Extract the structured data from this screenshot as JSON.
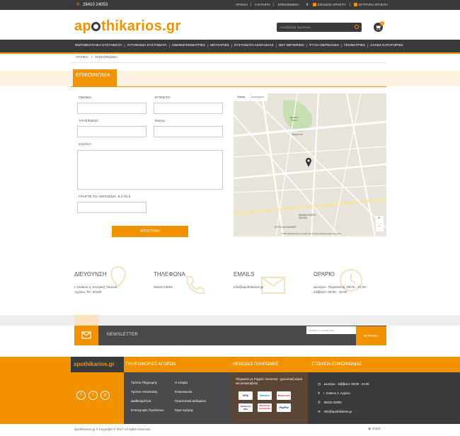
{
  "topbar": {
    "phone": "26410 24053",
    "links": [
      "ΑΡΧΙΚΗ",
      "Η ΕΤΑΙΡΙΑ",
      "ΕΠΙΚΟΙΝΩΝΙΑ"
    ],
    "login": "ΕΙΣΟΔΟΣ ΧΡΗΣΤΗ",
    "register": "ΕΓΓΡΑΦΗ ΧΡΗΣΤΗ"
  },
  "header": {
    "logo_a": "ap",
    "logo_b": "thikarios.gr",
    "search_placeholder": "Αναζήτηση προιόντα...",
    "cart_count": "0"
  },
  "nav": {
    "items": [
      "ΦΩΤΟΒΟΛΤΑΙΚΑ ΣΥΣΤΗΜΑΤΑ",
      "ΑΥΤΟΝΟΜΑ ΣΥΣΤΗΜΑΤΑ",
      "ΑΝΕΜΟΓΕΝΝΗΤΡΙΕΣ",
      "ΜΠΑΤΑΡΙΕΣ",
      "ΣΥΣΤΗΜΑΤΑ ΑΣΦΑΛΕΙΑΣ",
      "NET METERING",
      "ΨΥΞΗ ΘΕΡΜΑΝΣΗ",
      "ΓΕΝΝΗΤΡΙΕΣ",
      "ΑΛΛΕΣ ΚΑΤΗΓΟΡΙΕΣ"
    ]
  },
  "breadcrumb": {
    "home": "ΑΡΧΙΚΗ",
    "sep": "/",
    "current": "ΕΠΙΚΟΙΝΩΝΙΑ"
  },
  "page_title": "ΕΠΙΚΟΙΝΩΝΙΑ",
  "form": {
    "name": "ΟΝΟΜΑ:",
    "surname": "ΕΠΙΘΕΤΟ:",
    "phone": "ΤΗΛΕΦΩΝΟ:",
    "email": "EMAIL:",
    "comments": "ΣΧΟΛΙΑ:",
    "captcha": "ΓΡΑΨΤΕ ΤΟ ΑΘΡΟΙΣΜΑ: 8 ΣΥΝ 5",
    "send": "ΑΠΟΣΤΟΛΗ"
  },
  "map": {
    "tab_map": "Χάρτης",
    "tab_sat": "Δορυφόρος",
    "label_park": "Δημοτικό Πάρκο",
    "label_marketia": "Μαρκέτεια",
    "label_bavaria": "BAVARIA PARTS ΠΑΥΡΑΣ",
    "label_hotel": "HOTEL ALEXANDER",
    "zoom_in": "+",
    "zoom_out": "−",
    "attribution": "©2017 Δεδομένα χάρτη Google   Όροι Χρήσης   Αναφορά σφάλματος χάρτη"
  },
  "contact": {
    "address_title": "ΔΙΕΥΘΥΝΣΗ",
    "address_1": "Ι. Σταϊκου 2, Κεντρική Πλατεία",
    "address_2": "Αγρίνιο, ΤΚ: 30100",
    "phones_title": "ΤΗΛΕΦΩΝΑ",
    "phone": "26410 24053",
    "emails_title": "EMAILS",
    "email": "info@apothikarios.gr",
    "hours_title": "ΩΡΑΡΙΟ",
    "hours_1": "Δευτέρα - Παρασκευή: 09:00 - 21:00",
    "hours_2": "Σάββατο: 09:00 - 15:00"
  },
  "newsletter": {
    "label": "NEWSLETTER",
    "placeholder": "Γράψτε το email σας...",
    "button": "ΕΓΓΡΑΦΗ"
  },
  "footer": {
    "logo": "apothikarios.gr",
    "col1_title": "ΠΛΗΡΟΦΟΡΙΕΣ ΑΓΟΡΩΝ",
    "col1_links_a": [
      "Τρόποι Πληρωμής",
      "Τρόποι Αποστολής",
      "Διαθεσιμότητα",
      "Επιστροφές Προϊόντων"
    ],
    "col1_links_b": [
      "Η εταιρία",
      "Επικοινωνία",
      "Προσωπικά Δεδομένα",
      "Όροι Χρήσης"
    ],
    "col2_title": "ΜΕΘΟΔΟΙ ΠΛΗΡΩΜΗΣ",
    "col2_text": "Πληρώστε με Paypal, πιστωτική - χρεωστική κάρτα και αντικαταβολή",
    "cards": [
      "VISA",
      "Maestro",
      "MasterCard",
      "Verified by VISA",
      "MasterCard SecureCode",
      "PayPal"
    ],
    "col3_title": "ΣΤΟΙΧΕΙΑ ΕΠΙΚΟΙΝΩΝΙΑΣ",
    "col3_hours": "Δευτέρα - Σάββατο: 09:00 - 21:00",
    "col3_address": "Ι. Σταϊκου 2, Αγρίνιο",
    "col3_phone": "26410 24053",
    "col3_email": "info@apothikarios.gr",
    "copyright": "apothikarios.gr // Copyright © 2017 All rights reserved.",
    "credit": "wapp"
  },
  "colors": {
    "accent": "#f39200",
    "dark": "#3a3a3c"
  }
}
